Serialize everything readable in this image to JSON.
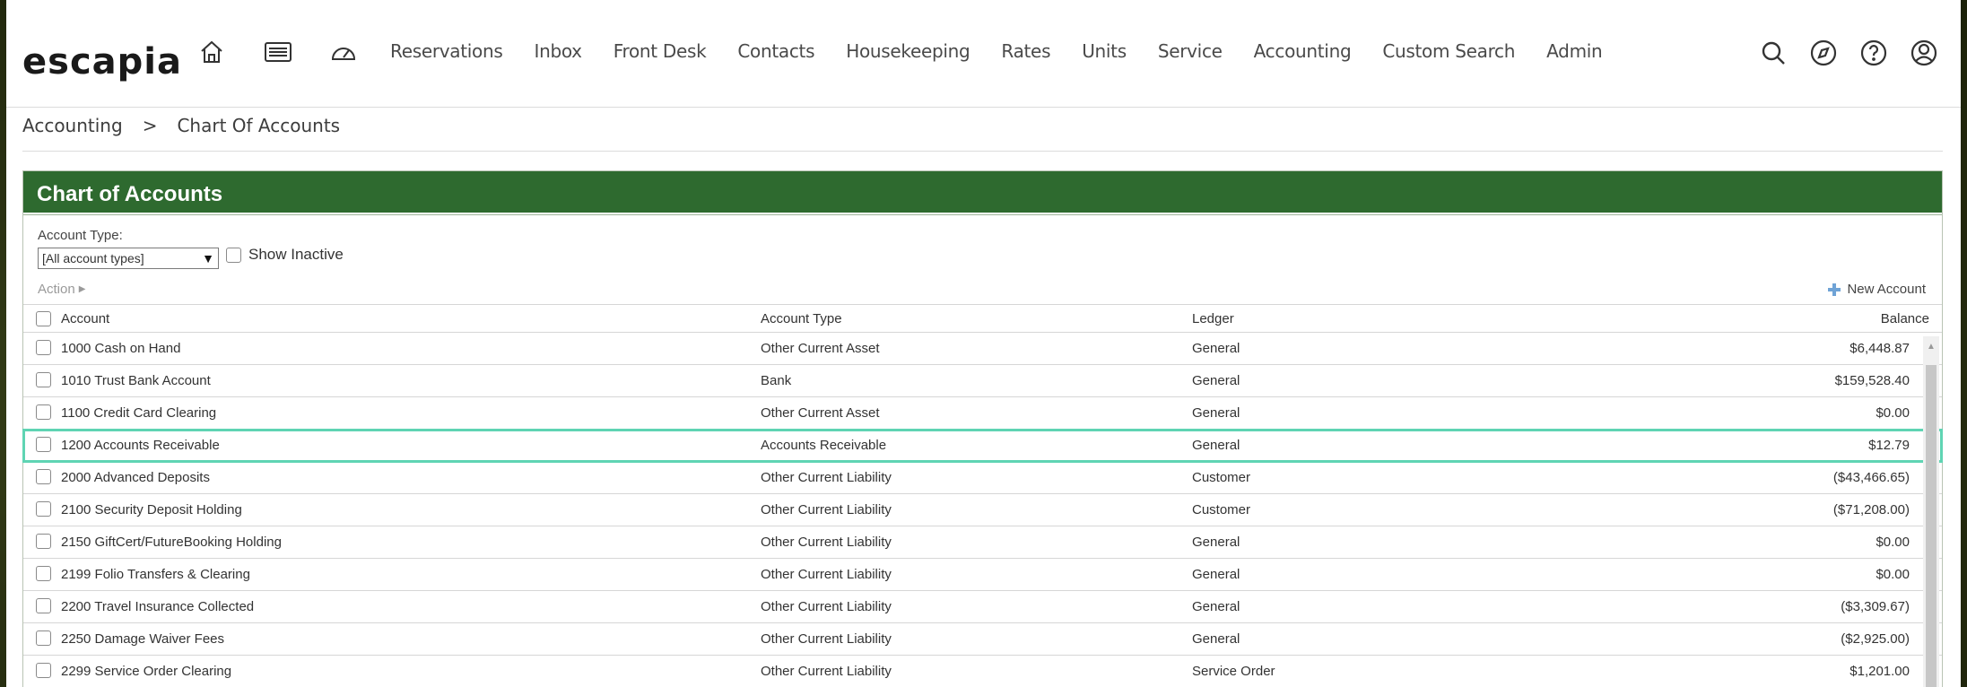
{
  "app": {
    "logo": "escapia"
  },
  "nav": {
    "icons": [
      "home-icon",
      "keyboard-icon",
      "dashboard-gauge-icon"
    ],
    "links": [
      "Reservations",
      "Inbox",
      "Front Desk",
      "Contacts",
      "Housekeeping",
      "Rates",
      "Units",
      "Service",
      "Accounting",
      "Custom Search",
      "Admin"
    ],
    "right_icons": [
      "search-icon",
      "compass-icon",
      "help-icon",
      "user-icon"
    ]
  },
  "breadcrumb": {
    "parent": "Accounting",
    "separator": ">",
    "current": "Chart Of Accounts"
  },
  "panel": {
    "title": "Chart of Accounts",
    "account_type_label": "Account Type:",
    "account_type_selected": "[All account types]",
    "show_inactive_label": "Show Inactive",
    "action_label": "Action",
    "new_account_label": "New Account"
  },
  "table": {
    "columns": [
      "Account",
      "Account Type",
      "Ledger",
      "Balance"
    ],
    "rows": [
      {
        "account": "1000 Cash on Hand",
        "type": "Other Current Asset",
        "ledger": "General",
        "balance": "$6,448.87"
      },
      {
        "account": "1010 Trust Bank Account",
        "type": "Bank",
        "ledger": "General",
        "balance": "$159,528.40"
      },
      {
        "account": "1100 Credit Card Clearing",
        "type": "Other Current Asset",
        "ledger": "General",
        "balance": "$0.00"
      },
      {
        "account": "1200 Accounts Receivable",
        "type": "Accounts Receivable",
        "ledger": "General",
        "balance": "$12.79"
      },
      {
        "account": "2000 Advanced Deposits",
        "type": "Other Current Liability",
        "ledger": "Customer",
        "balance": "($43,466.65)"
      },
      {
        "account": "2100 Security Deposit Holding",
        "type": "Other Current Liability",
        "ledger": "Customer",
        "balance": "($71,208.00)"
      },
      {
        "account": "2150 GiftCert/FutureBooking Holding",
        "type": "Other Current Liability",
        "ledger": "General",
        "balance": "$0.00"
      },
      {
        "account": "2199 Folio Transfers & Clearing",
        "type": "Other Current Liability",
        "ledger": "General",
        "balance": "$0.00"
      },
      {
        "account": "2200 Travel Insurance Collected",
        "type": "Other Current Liability",
        "ledger": "General",
        "balance": "($3,309.67)"
      },
      {
        "account": "2250 Damage Waiver Fees",
        "type": "Other Current Liability",
        "ledger": "General",
        "balance": "($2,925.00)"
      },
      {
        "account": "2299 Service Order Clearing",
        "type": "Other Current Liability",
        "ledger": "Service Order",
        "balance": "$1,201.00"
      }
    ],
    "highlighted_row": 3
  },
  "colors": {
    "header_green": "#2e6a2f",
    "highlight": "#5fd4b3"
  }
}
